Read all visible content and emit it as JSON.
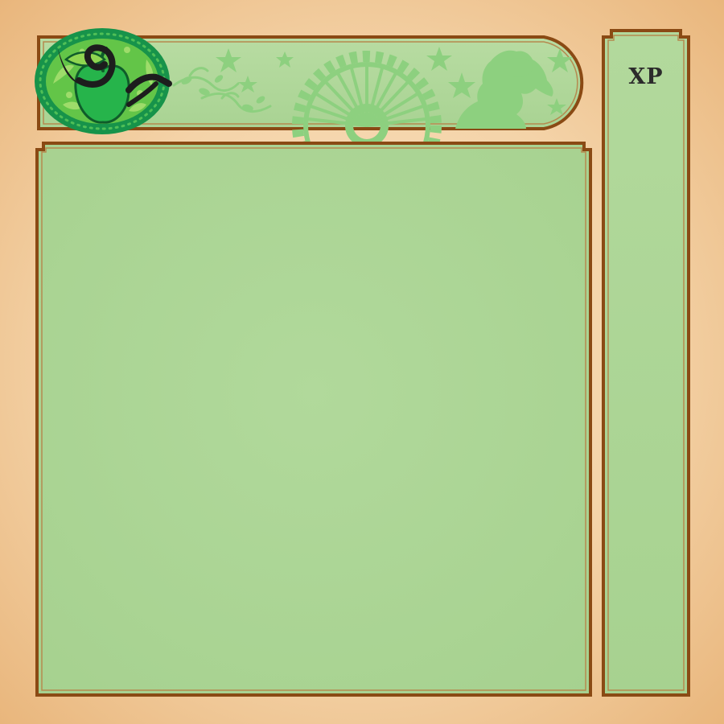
{
  "xp_panel": {
    "label": "XP"
  },
  "colors": {
    "background": "#f4d3a8",
    "border": "#8a4a14",
    "panel_fill": "#aed597",
    "panel_inner_line": "#b58a4f",
    "emblem_ring": "#17934a",
    "emblem_fill": "#5fc146",
    "apple": "#27b24a",
    "serpent": "#1d1d1d",
    "header_silhouettes": "#8dd07f"
  },
  "icons": {
    "emblem": "apple-serpent-emblem-icon",
    "decorations": [
      "vine-flourish-icon",
      "star-icon",
      "gear-icon",
      "explorer-silhouette-icon"
    ]
  }
}
